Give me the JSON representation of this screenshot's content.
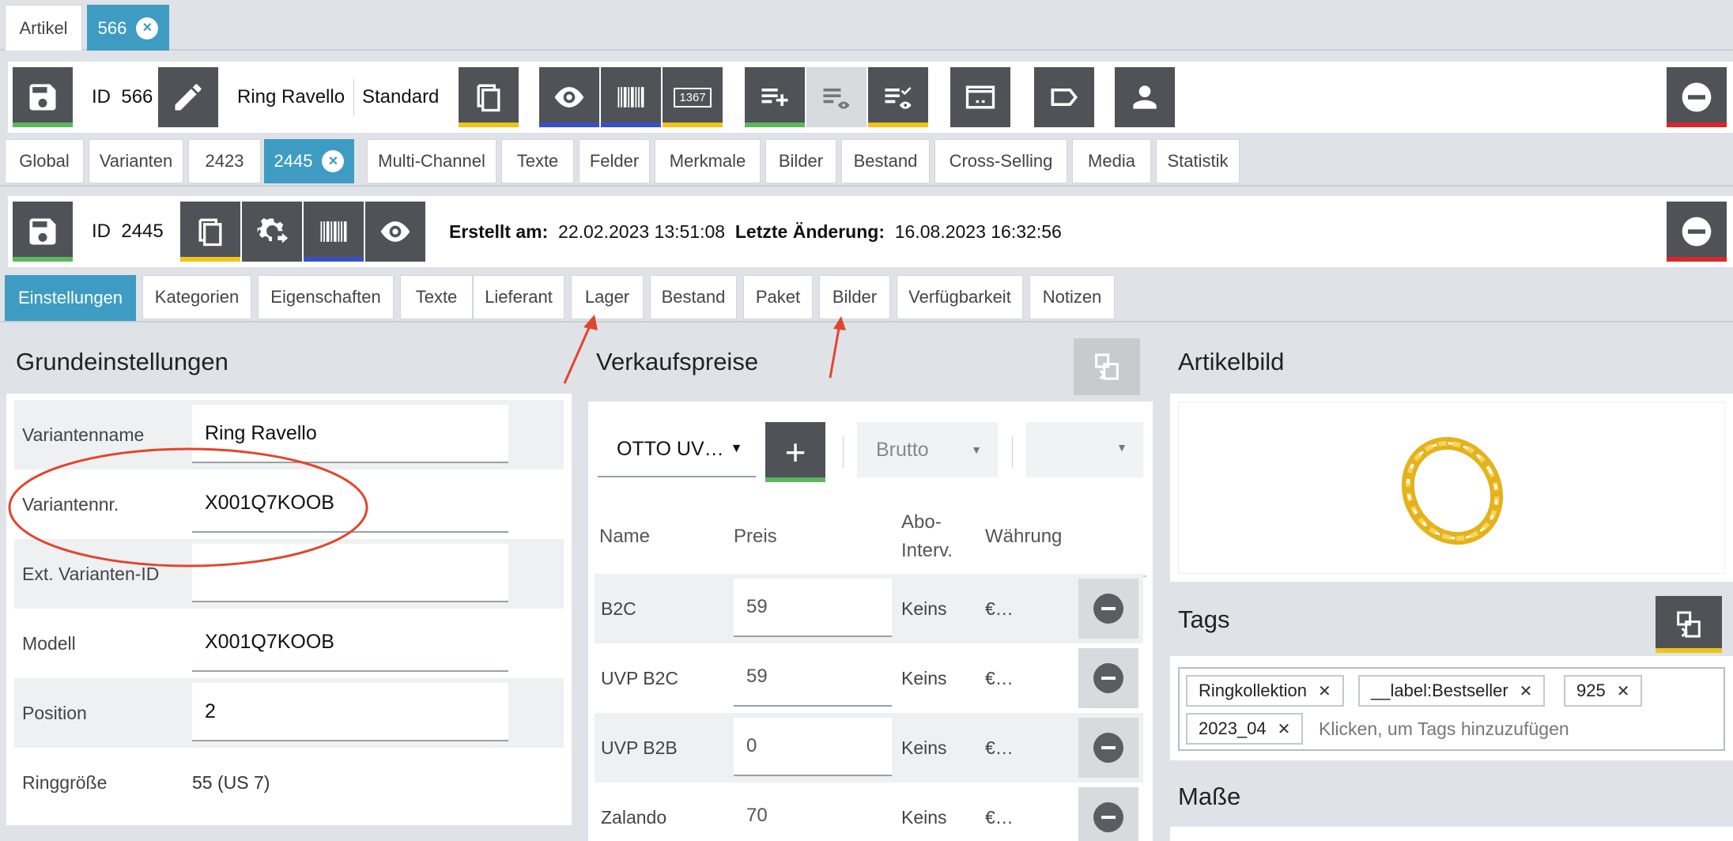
{
  "top_tabs": {
    "artikel": "Artikel",
    "id_tab": "566"
  },
  "article_toolbar": {
    "id_label": "ID",
    "id_value": "566",
    "name": "Ring Ravello",
    "type": "Standard",
    "barcode_number": "1367"
  },
  "article_tabs": [
    "Global",
    "Varianten",
    "2423",
    "2445",
    "Multi-Channel",
    "Texte",
    "Felder",
    "Merkmale",
    "Bilder",
    "Bestand",
    "Cross-Selling",
    "Media",
    "Statistik"
  ],
  "variant_toolbar": {
    "id_label": "ID",
    "id_value": "2445",
    "created_label": "Erstellt am:",
    "created_value": "22.02.2023 13:51:08",
    "changed_label": "Letzte Änderung:",
    "changed_value": "16.08.2023 16:32:56"
  },
  "variant_tabs": [
    "Einstellungen",
    "Kategorien",
    "Eigenschaften",
    "Texte",
    "Lieferant",
    "Lager",
    "Bestand",
    "Paket",
    "Bilder",
    "Verfügbarkeit",
    "Notizen"
  ],
  "basic_settings": {
    "title": "Grundeinstellungen",
    "rows": [
      {
        "label": "Variantenname",
        "value": "Ring Ravello"
      },
      {
        "label": "Variantennr.",
        "value": "X001Q7KOOB"
      },
      {
        "label": "Ext. Varianten-ID",
        "value": ""
      },
      {
        "label": "Modell",
        "value": "X001Q7KOOB"
      },
      {
        "label": "Position",
        "value": "2"
      },
      {
        "label": "Ringgröße",
        "value": "55 (US 7)"
      }
    ]
  },
  "sales_prices": {
    "title": "Verkaufspreise",
    "channel_select": "OTTO UV…",
    "gross_select": "Brutto",
    "columns": {
      "name": "Name",
      "price": "Preis",
      "abo": "Abo-\nInterv.",
      "currency": "Währung"
    },
    "rows": [
      {
        "name": "B2C",
        "price": "59",
        "abo": "Keins",
        "currency": "€…"
      },
      {
        "name": "UVP B2C",
        "price": "59",
        "abo": "Keins",
        "currency": "€…"
      },
      {
        "name": "UVP B2B",
        "price": "0",
        "abo": "Keins",
        "currency": "€…"
      },
      {
        "name": "Zalando",
        "price": "70",
        "abo": "Keins",
        "currency": "€…"
      }
    ]
  },
  "article_image": {
    "title": "Artikelbild"
  },
  "tags": {
    "title": "Tags",
    "items": [
      "Ringkollektion",
      "__label:Bestseller",
      "925",
      "2023_04"
    ],
    "placeholder": "Klicken, um Tags hinzuzufügen"
  },
  "dimensions": {
    "title": "Maße"
  },
  "colors": {
    "accent_blue": "#3e9cc3",
    "button_dark": "#4f5357",
    "green": "#5cb85c",
    "yellow": "#f0c419",
    "blue_bar": "#3a4fc4",
    "red": "#d9262c",
    "annotation_red": "#e2452b"
  }
}
